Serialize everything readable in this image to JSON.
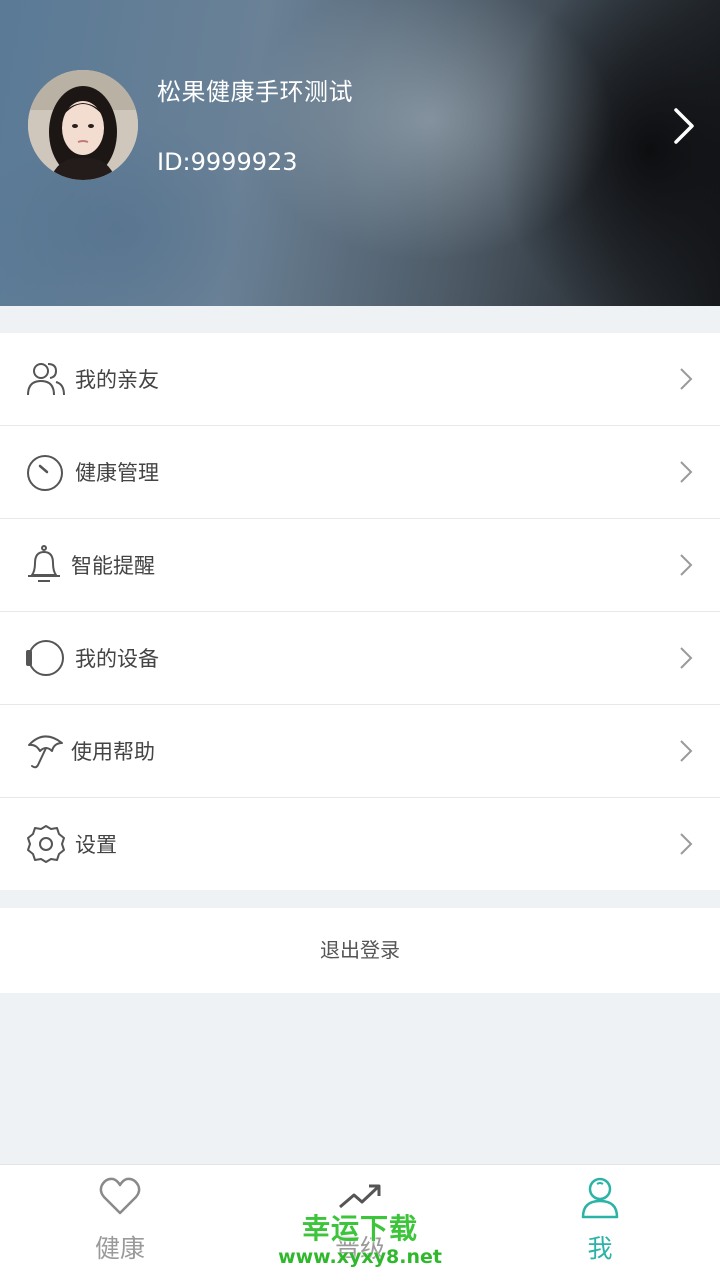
{
  "profile": {
    "name": "松果健康手环测试",
    "id_text": "ID:9999923"
  },
  "menu": {
    "items": [
      {
        "label": "我的亲友",
        "icon": "friends-icon"
      },
      {
        "label": "健康管理",
        "icon": "gauge-icon"
      },
      {
        "label": "智能提醒",
        "icon": "bell-icon"
      },
      {
        "label": "我的设备",
        "icon": "watch-icon"
      },
      {
        "label": "使用帮助",
        "icon": "umbrella-icon"
      },
      {
        "label": "设置",
        "icon": "gear-icon"
      }
    ]
  },
  "logout_label": "退出登录",
  "tabbar": {
    "tabs": [
      {
        "label": "健康",
        "icon": "heart-icon"
      },
      {
        "label": "晋级",
        "icon": "trend-up-icon"
      },
      {
        "label": "我",
        "icon": "person-icon",
        "active": true
      }
    ]
  },
  "watermark": {
    "title": "幸运下载",
    "url": "www.xyxy8.net"
  },
  "colors": {
    "accent": "#2bb3a6",
    "inactive": "#9a9a9a",
    "background": "#eef2f5"
  }
}
